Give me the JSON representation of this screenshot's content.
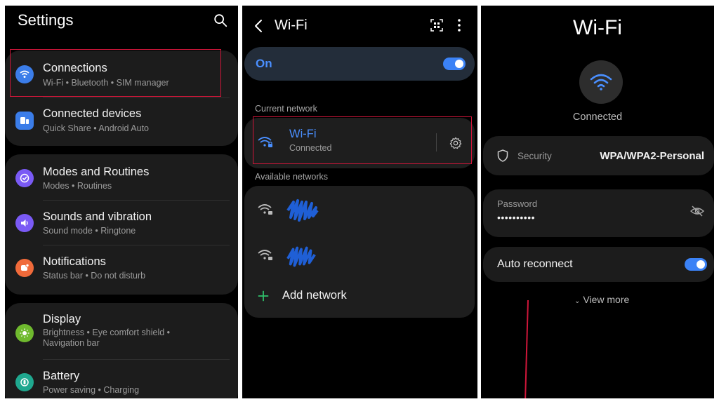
{
  "settings": {
    "title": "Settings",
    "items": [
      {
        "title": "Connections",
        "subtitle": "Wi-Fi  •  Bluetooth  •  SIM manager",
        "icon": "wifi-icon",
        "color": "#3b7de9"
      },
      {
        "title": "Connected devices",
        "subtitle": "Quick Share  •  Android Auto",
        "icon": "devices-icon",
        "color": "#3b7de9"
      },
      {
        "title": "Modes and Routines",
        "subtitle": "Modes  •  Routines",
        "icon": "check-circle-icon",
        "color": "#7a5af5"
      },
      {
        "title": "Sounds and vibration",
        "subtitle": "Sound mode  •  Ringtone",
        "icon": "volume-icon",
        "color": "#7a5af5"
      },
      {
        "title": "Notifications",
        "subtitle": "Status bar  •  Do not disturb",
        "icon": "notification-icon",
        "color": "#f06a3a"
      },
      {
        "title": "Display",
        "subtitle_line1": "Brightness  •  Eye comfort shield  •",
        "subtitle_line2": "Navigation bar",
        "icon": "sun-icon",
        "color": "#6fb92e"
      },
      {
        "title": "Battery",
        "subtitle": "Power saving  •  Charging",
        "icon": "battery-icon",
        "color": "#1fa88f"
      }
    ]
  },
  "wifi_list": {
    "title": "Wi-Fi",
    "toggle_label": "On",
    "toggle_on": true,
    "current_network_label": "Current network",
    "current_network": {
      "name": "Wi-Fi",
      "status": "Connected"
    },
    "available_label": "Available networks",
    "add_network": "Add network"
  },
  "wifi_detail": {
    "title": "Wi-Fi",
    "status": "Connected",
    "security_label": "Security",
    "security_value": "WPA/WPA2-Personal",
    "password_label": "Password",
    "password_value": "••••••••••",
    "auto_reconnect_label": "Auto reconnect",
    "auto_reconnect_on": true,
    "view_more": "View more"
  },
  "colors": {
    "accent_blue": "#3b82f6",
    "highlight_red": "#d0163a",
    "panel_bg": "#000000",
    "card_bg": "#1c1c1c"
  }
}
